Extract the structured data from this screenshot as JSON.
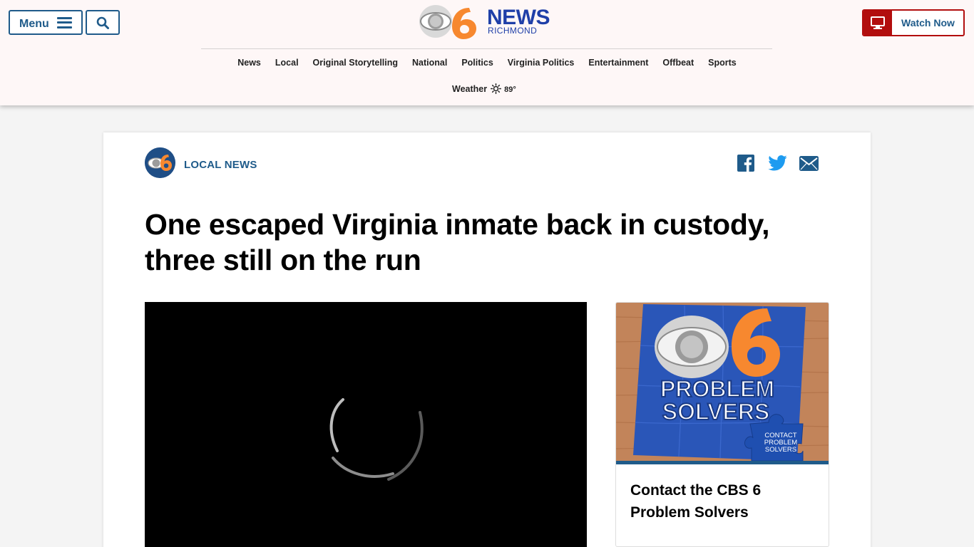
{
  "header": {
    "menu_label": "Menu",
    "logo_word": "NEWS",
    "logo_sub": "RICHMOND",
    "watch_label": "Watch Now",
    "nav": [
      {
        "label": "News"
      },
      {
        "label": "Local"
      },
      {
        "label": "Original Storytelling"
      },
      {
        "label": "National"
      },
      {
        "label": "Politics"
      },
      {
        "label": "Virginia Politics"
      },
      {
        "label": "Entertainment"
      },
      {
        "label": "Offbeat"
      },
      {
        "label": "Sports"
      }
    ],
    "weather": {
      "label": "Weather",
      "temp": "89°",
      "icon": "sun-icon"
    }
  },
  "article": {
    "section": "LOCAL NEWS",
    "headline": "One escaped Virginia inmate back in custody, three still on the run",
    "share_icons": [
      "facebook-icon",
      "twitter-icon",
      "email-icon"
    ]
  },
  "promo": {
    "title": "Contact the CBS 6 Problem Solvers",
    "image_text_line1": "PROBLEM",
    "image_text_line2": "SOLVERS",
    "piece_text": [
      "CONTACT",
      "PROBLEM",
      "SOLVERS"
    ]
  },
  "colors": {
    "header_bg": "#fef7f7",
    "brand_blue": "#1f5b8a",
    "logo_blue": "#1f3fa8",
    "watch_red": "#b20e0e",
    "cbs_orange": "#f7882f"
  }
}
